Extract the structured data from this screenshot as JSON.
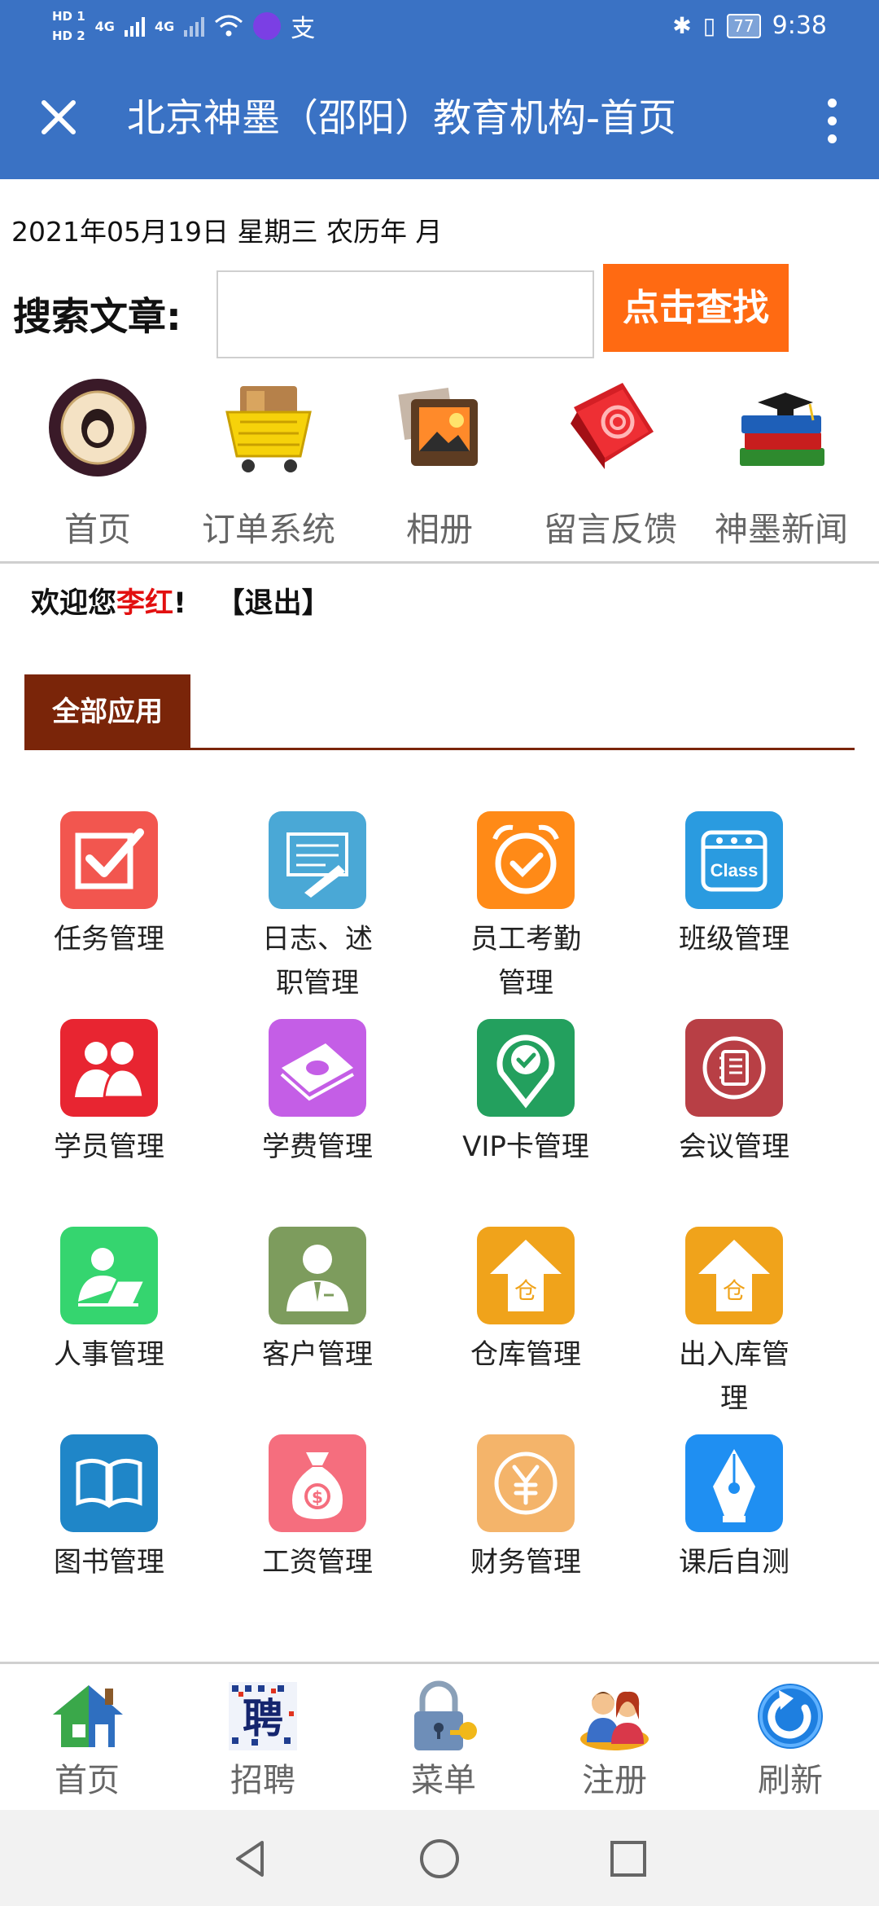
{
  "status_bar": {
    "hd1": "HD 1",
    "hd2": "HD 2",
    "net1": "4G",
    "net2": "4G",
    "battery": "77",
    "time": "9:38"
  },
  "header": {
    "title": "北京神墨（邵阳）教育机构-首页"
  },
  "date_line": "2021年05月19日 星期三 农历年 月",
  "search": {
    "label": "搜索文章:",
    "value": "",
    "button_label": "点击查找"
  },
  "quick_nav": [
    {
      "label": "首页",
      "icon": "school-seal-icon"
    },
    {
      "label": "订单系统",
      "icon": "shopping-basket-icon"
    },
    {
      "label": "相册",
      "icon": "photo-album-icon"
    },
    {
      "label": "留言反馈",
      "icon": "notebook-icon"
    },
    {
      "label": "神墨新闻",
      "icon": "books-icon"
    }
  ],
  "welcome": {
    "prefix": "欢迎您",
    "name": "李红",
    "suffix": "!",
    "logout": "【退出】"
  },
  "section": {
    "title": "全部应用"
  },
  "apps": [
    {
      "label": "任务管理",
      "icon": "checkbox-icon",
      "color": "#f2564f"
    },
    {
      "label": "日志、述职管理",
      "icon": "pen-paper-icon",
      "color": "#4aa8d6"
    },
    {
      "label": "员工考勤管理",
      "icon": "alarm-clock-icon",
      "color": "#ff8a17"
    },
    {
      "label": "班级管理",
      "icon": "class-calendar-icon",
      "color": "#2a9be0"
    },
    {
      "label": "学员管理",
      "icon": "students-icon",
      "color": "#e82531"
    },
    {
      "label": "学费管理",
      "icon": "money-icon",
      "color": "#c45ee6"
    },
    {
      "label": "VIP卡管理",
      "icon": "location-check-icon",
      "color": "#23a05e"
    },
    {
      "label": "会议管理",
      "icon": "notebook-icon",
      "color": "#b83f45"
    },
    {
      "label": "人事管理",
      "icon": "person-laptop-icon",
      "color": "#35d56f"
    },
    {
      "label": "客户管理",
      "icon": "customer-icon",
      "color": "#7d9c5d"
    },
    {
      "label": "仓库管理",
      "icon": "warehouse-arrow-icon",
      "color": "#f0a31b"
    },
    {
      "label": "出入库管理",
      "icon": "warehouse-arrow-icon",
      "color": "#f0a31b"
    },
    {
      "label": "图书管理",
      "icon": "book-icon",
      "color": "#1f86c8"
    },
    {
      "label": "工资管理",
      "icon": "money-bag-icon",
      "color": "#f56e7e"
    },
    {
      "label": "财务管理",
      "icon": "yen-coin-icon",
      "color": "#f4b46a"
    },
    {
      "label": "课后自测",
      "icon": "pen-nib-icon",
      "color": "#1f8ff2"
    }
  ],
  "bottom_nav": [
    {
      "label": "首页",
      "icon": "house-icon"
    },
    {
      "label": "招聘",
      "icon": "recruit-icon"
    },
    {
      "label": "菜单",
      "icon": "lock-key-icon"
    },
    {
      "label": "注册",
      "icon": "users-icon"
    },
    {
      "label": "刷新",
      "icon": "refresh-icon"
    }
  ]
}
